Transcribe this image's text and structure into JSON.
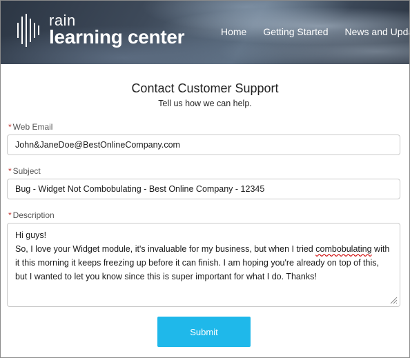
{
  "header": {
    "logo": {
      "top": "rain",
      "bottom": "learning center"
    },
    "nav": [
      "Home",
      "Getting Started",
      "News and Upda"
    ]
  },
  "form": {
    "title": "Contact Customer Support",
    "subtitle": "Tell us how we can help.",
    "required_marker": "*",
    "email": {
      "label": "Web Email",
      "value": "John&JaneDoe@BestOnlineCompany.com"
    },
    "subject": {
      "label": "Subject",
      "value": "Bug - Widget Not Combobulating - Best Online Company - 12345"
    },
    "description": {
      "label": "Description",
      "line1": "Hi guys!",
      "line2_pre": "So, I love your Widget module, it's invaluable for my business, but when I tried ",
      "misspelled": "combobulating",
      "line2_post": " with it this morning it keeps freezing up before it can finish. I am hoping you're already on top of this, but I wanted to let you know since this is super important for what I do. Thanks!"
    },
    "submit_label": "Submit"
  },
  "colors": {
    "accent": "#1fb8ea",
    "required": "#c23934",
    "header_bg": "#3e4a5a"
  }
}
